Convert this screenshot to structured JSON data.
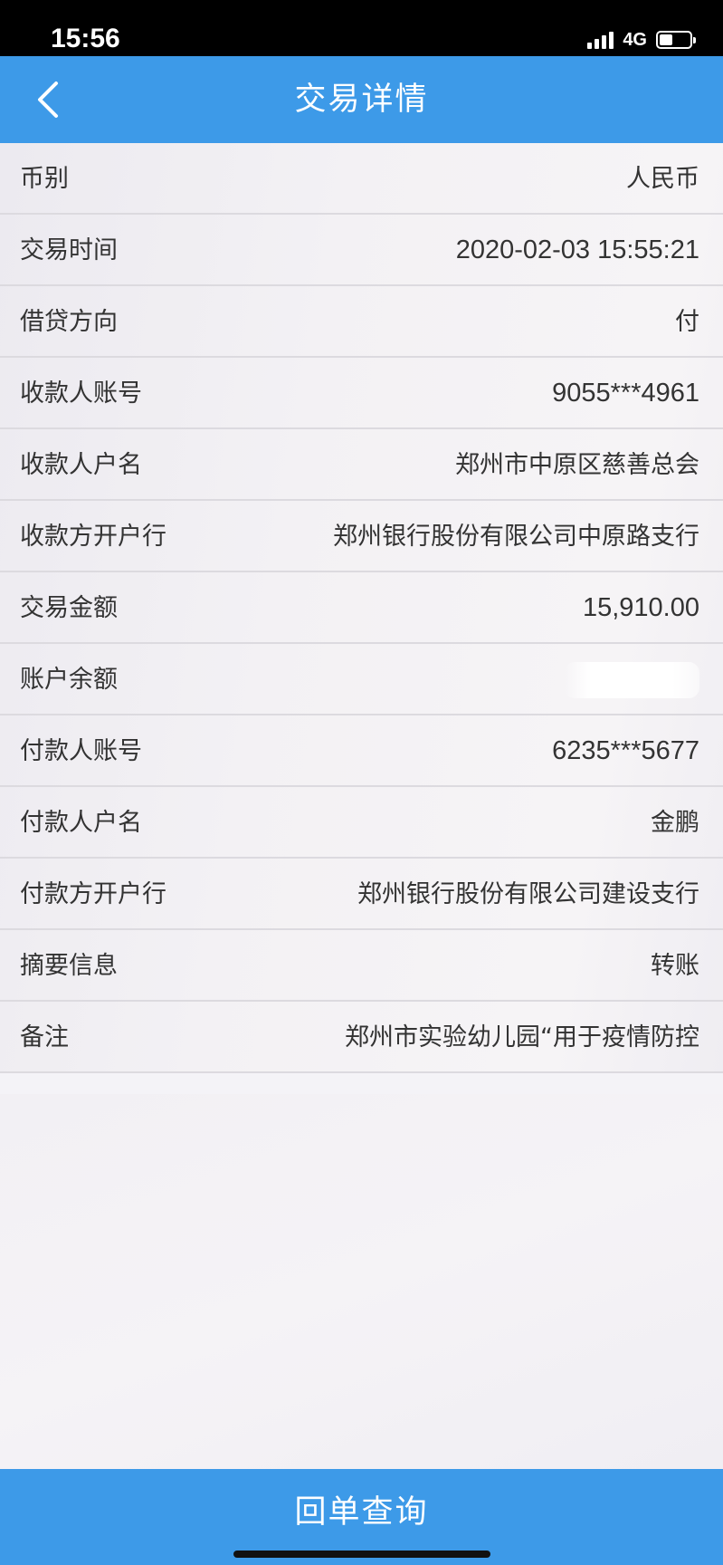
{
  "status_bar": {
    "time": "15:56",
    "network": "4G",
    "battery_percent": 45
  },
  "header": {
    "title": "交易详情",
    "back_icon": "chevron-left-icon"
  },
  "details": [
    {
      "label": "币别",
      "value": "人民币"
    },
    {
      "label": "交易时间",
      "value": "2020-02-03 15:55:21"
    },
    {
      "label": "借贷方向",
      "value": "付"
    },
    {
      "label": "收款人账号",
      "value": "9055***4961"
    },
    {
      "label": "收款人户名",
      "value": "郑州市中原区慈善总会"
    },
    {
      "label": "收款方开户行",
      "value": "郑州银行股份有限公司中原路支行"
    },
    {
      "label": "交易金额",
      "value": "15,910.00"
    },
    {
      "label": "账户余额",
      "value": null
    },
    {
      "label": "付款人账号",
      "value": "6235***5677"
    },
    {
      "label": "付款人户名",
      "value": "金鹏"
    },
    {
      "label": "付款方开户行",
      "value": "郑州银行股份有限公司建设支行"
    },
    {
      "label": "摘要信息",
      "value": "转账"
    },
    {
      "label": "备注",
      "value": "郑州市实验幼儿园“用于疫情防控"
    }
  ],
  "footer": {
    "button_label": "回单查询"
  },
  "colors": {
    "accent": "#3d9ae8",
    "text": "#333333",
    "divider": "#dcdadf"
  }
}
